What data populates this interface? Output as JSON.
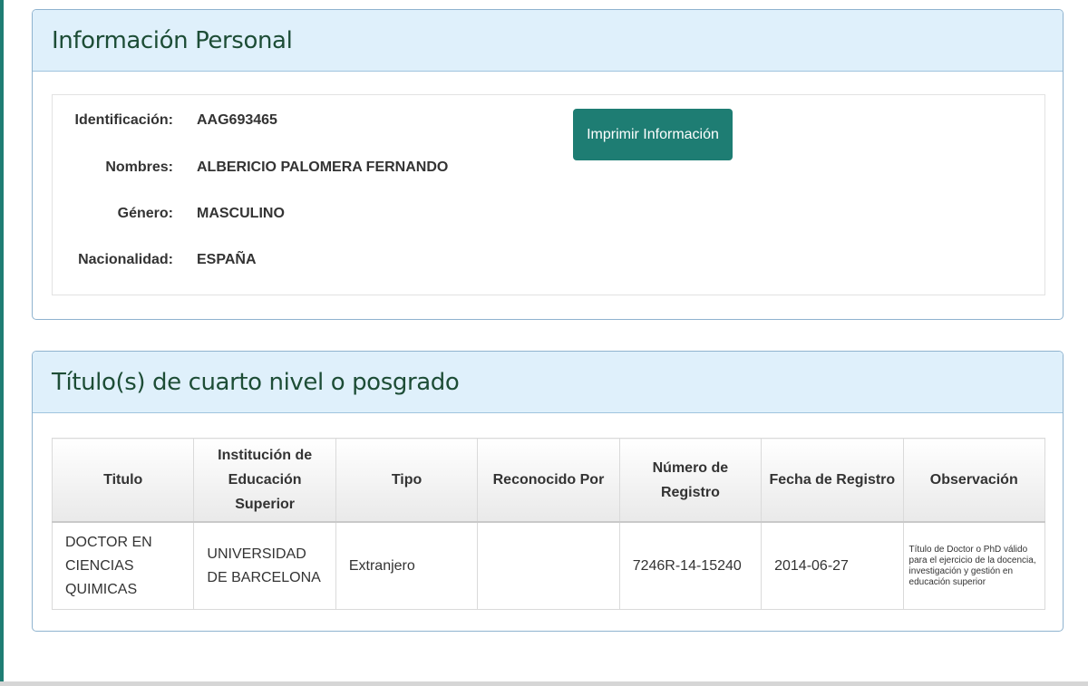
{
  "personal": {
    "heading": "Información Personal",
    "print_button": "Imprimir Información",
    "fields": [
      {
        "label": "Identificación:",
        "value": "AAG693465"
      },
      {
        "label": "Nombres:",
        "value": "ALBERICIO PALOMERA FERNANDO"
      },
      {
        "label": "Género:",
        "value": "MASCULINO"
      },
      {
        "label": "Nacionalidad:",
        "value": "ESPAÑA"
      }
    ]
  },
  "degrees": {
    "heading": "Título(s) de cuarto nivel o posgrado",
    "columns": [
      "Titulo",
      "Institución de Educación Superior",
      "Tipo",
      "Reconocido Por",
      "Número de Registro",
      "Fecha de Registro",
      "Observación"
    ],
    "rows": [
      {
        "titulo": "DOCTOR EN CIENCIAS QUIMICAS",
        "institucion": "UNIVERSIDAD DE BARCELONA",
        "tipo": "Extranjero",
        "reconocido": "",
        "numero": "7246R-14-15240",
        "fecha": "2014-06-27",
        "observacion": "Título de Doctor o PhD válido para el ejercicio de la docencia, investigación y gestión en educación superior"
      }
    ]
  },
  "colors": {
    "accent": "#1e7d73",
    "heading_bg": "#dff0fb",
    "heading_text": "#1d4d36",
    "panel_border": "#8fb3cf"
  }
}
